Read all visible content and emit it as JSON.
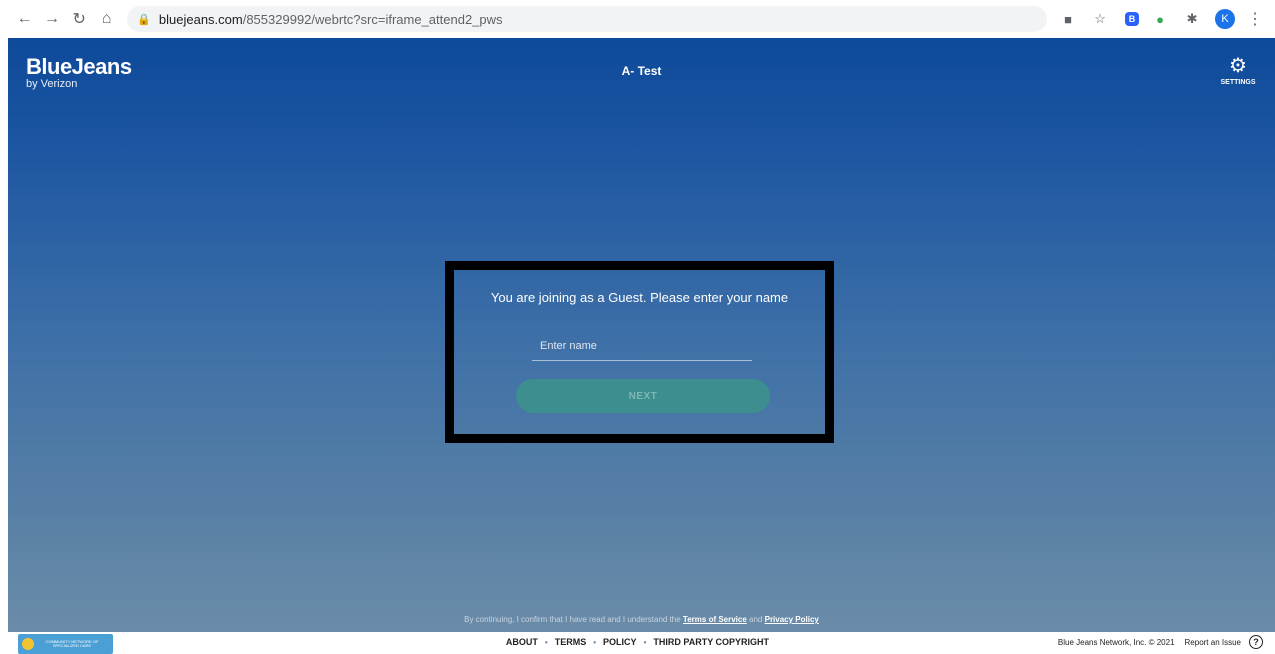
{
  "browser": {
    "url_host": "bluejeans.com",
    "url_path": "/855329992/webrtc?src=iframe_attend2_pws",
    "avatar_letter": "K"
  },
  "app": {
    "brand": "BlueJeans",
    "brand_sub": "by Verizon",
    "meeting_title": "A- Test",
    "settings_label": "SETTINGS"
  },
  "dialog": {
    "prompt": "You are joining as a Guest. Please enter your name",
    "name_placeholder": "Enter name",
    "next_label": "NEXT"
  },
  "consent": {
    "prefix": "By continuing, I confirm that I have read and I understand the ",
    "terms_link": "Terms of Service",
    "middle": " and ",
    "privacy_link": "Privacy Policy"
  },
  "footer": {
    "links": [
      "ABOUT",
      "TERMS",
      "POLICY",
      "THIRD PARTY COPYRIGHT"
    ],
    "copyright": "Blue Jeans Network, Inc. © 2021",
    "report": "Report an Issue",
    "org_logo_text": "COMMUNITY NETWORK OF SPECIALIZED CARE"
  }
}
